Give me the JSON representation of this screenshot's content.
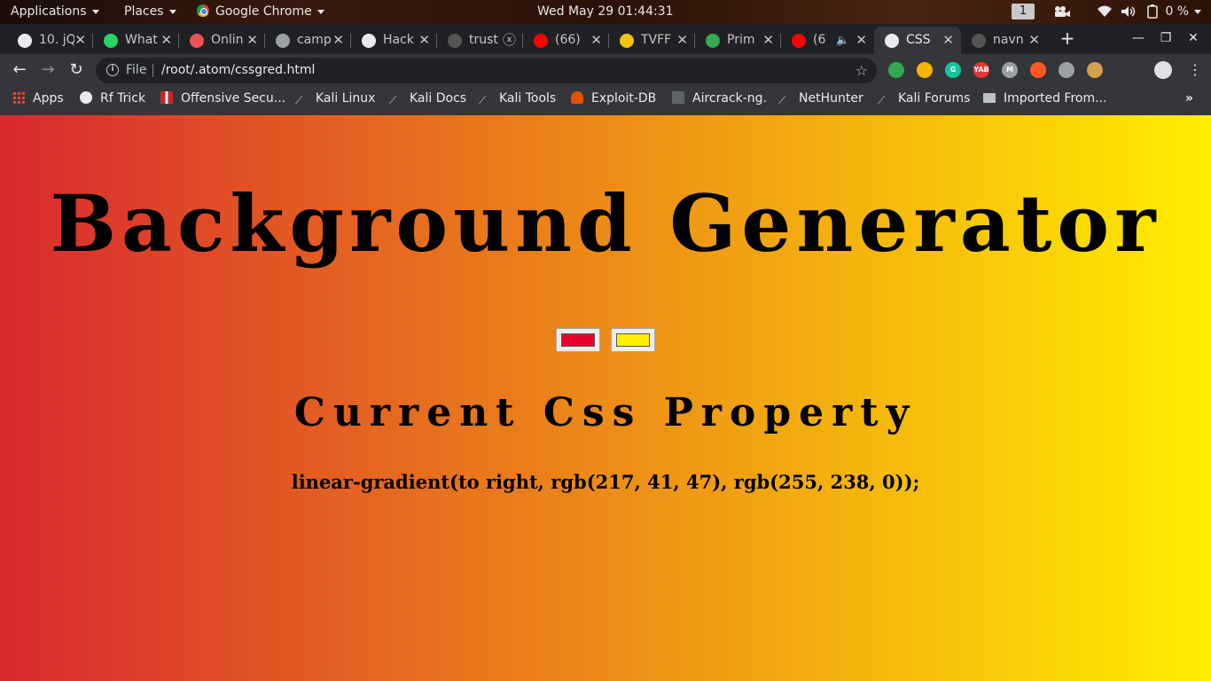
{
  "top_panel": {
    "applications": "Applications",
    "places": "Places",
    "app_name": "Google Chrome",
    "datetime": "Wed May 29  01:44:31",
    "workspace": "1",
    "battery": "0 %"
  },
  "tabs": [
    {
      "title": "10. jQ",
      "favicon": "#e8eaed"
    },
    {
      "title": "What",
      "favicon": "#25d366"
    },
    {
      "title": "Onlin",
      "favicon": "#ec5252"
    },
    {
      "title": "camp",
      "favicon": "#9aa0a6"
    },
    {
      "title": "Hack",
      "favicon": "#e8eaed"
    },
    {
      "title": "trust",
      "favicon": "#555555"
    },
    {
      "title": "(66)",
      "favicon": "#ff0000"
    },
    {
      "title": "TVFF",
      "favicon": "#f4c20d"
    },
    {
      "title": "Prim",
      "favicon": "#34a853"
    },
    {
      "title": "(6",
      "favicon": "#ff0000"
    },
    {
      "title": "CSS",
      "favicon": "#e8eaed"
    },
    {
      "title": "navn",
      "favicon": "#555555"
    }
  ],
  "toolbar": {
    "scheme": "File",
    "url": "/root/.atom/cssgred.html"
  },
  "extensions": [
    {
      "name": "extension-1-icon",
      "color": "#34a853",
      "label": ""
    },
    {
      "name": "extension-2-icon",
      "color": "#f4b400",
      "label": ""
    },
    {
      "name": "grammarly-icon",
      "color": "#15c39a",
      "label": "G"
    },
    {
      "name": "yab-icon",
      "color": "#e53935",
      "label": "YAB"
    },
    {
      "name": "metamask-icon",
      "color": "#9aa0a6",
      "label": "M"
    },
    {
      "name": "colorpick-icon",
      "color": "#ff5722",
      "label": ""
    },
    {
      "name": "shield-icon",
      "color": "#9aa0a6",
      "label": ""
    },
    {
      "name": "cookie-icon",
      "color": "#d4a24c",
      "label": ""
    }
  ],
  "bookmarks": [
    {
      "label": "Apps"
    },
    {
      "label": "Rf Trick"
    },
    {
      "label": "Offensive Secu..."
    },
    {
      "label": "Kali Linux"
    },
    {
      "label": "Kali Docs"
    },
    {
      "label": "Kali Tools"
    },
    {
      "label": "Exploit-DB"
    },
    {
      "label": "Aircrack-ng."
    },
    {
      "label": "NetHunter"
    },
    {
      "label": "Kali Forums"
    },
    {
      "label": "Imported From..."
    }
  ],
  "page": {
    "heading": "Background Generator",
    "color1": "#e8002c",
    "color2": "#ffee00",
    "subheading": "Current Css Property",
    "css_value": "linear-gradient(to right, rgb(217, 41, 47), rgb(255, 238, 0));"
  }
}
